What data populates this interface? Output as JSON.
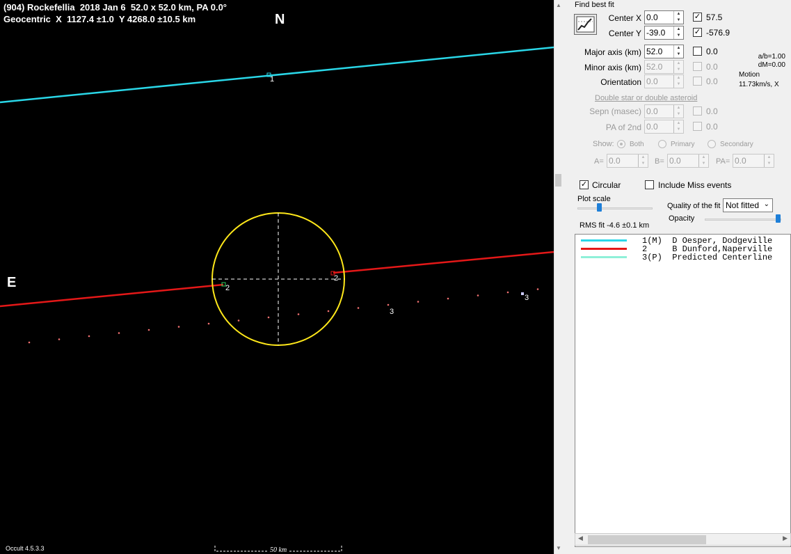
{
  "plot": {
    "title_line1": "(904) Rockefellia  2018 Jan 6  52.0 x 52.0 km, PA 0.0°",
    "title_line2": "Geocentric  X  1127.4 ±1.0  Y 4268.0 ±10.5 km",
    "north_label": "N",
    "east_label": "E",
    "chord_labels": {
      "c1": "1",
      "c2a": "2",
      "c2b": "2",
      "c3a": "3",
      "c3b": "3"
    },
    "scale_label": "50 km",
    "version": "Occult 4.5.3.3",
    "colors": {
      "chord1": "#2ad7e8",
      "chord2": "#e41818",
      "ellipse": "#ffe81a",
      "predicted": "#f07070"
    }
  },
  "panel": {
    "find_best_fit": "Find best fit",
    "center_x": {
      "label": "Center X",
      "value": "0.0",
      "check_value": "57.5",
      "checked": true
    },
    "center_y": {
      "label": "Center Y",
      "value": "-39.0",
      "check_value": "-576.9",
      "checked": true
    },
    "major_axis": {
      "label": "Major axis (km)",
      "value": "52.0",
      "check_value": "0.0",
      "checked": false
    },
    "minor_axis": {
      "label": "Minor axis (km)",
      "value": "52.0",
      "check_value": "0.0"
    },
    "orientation": {
      "label": "Orientation",
      "value": "0.0",
      "check_value": "0.0"
    },
    "ratio": "a/b=1.00",
    "dm": "dM=0.00",
    "motion_label": "Motion",
    "motion_value": "11.73km/s, X",
    "double_star_link": "Double star  or  double asteroid",
    "sepn": {
      "label": "Sepn (masec)",
      "value": "0.0",
      "check_value": "0.0"
    },
    "pa2nd": {
      "label": "PA of 2nd",
      "value": "0.0",
      "check_value": "0.0"
    },
    "show_label": "Show:",
    "show_both": "Both",
    "show_primary": "Primary",
    "show_secondary": "Secondary",
    "a_label": "A=",
    "a_value": "0.0",
    "b_label": "B=",
    "b_value": "0.0",
    "pa_label": "PA=",
    "pa_value": "0.0",
    "circular": "Circular",
    "include_miss": "Include Miss events",
    "plot_scale": "Plot scale",
    "quality_label": "Quality of the fit",
    "quality_value": "Not fitted",
    "opacity": "Opacity",
    "rms_fit": "RMS fit  -4.6 ±0.1 km"
  },
  "legend": [
    {
      "color": "#2ad7e8",
      "text": "1(M)  D Oesper, Dodgeville"
    },
    {
      "color": "#e41818",
      "text": "2     B Dunford,Naperville"
    },
    {
      "color": "#8ff0d8",
      "text": "3(P)  Predicted Centerline"
    }
  ]
}
